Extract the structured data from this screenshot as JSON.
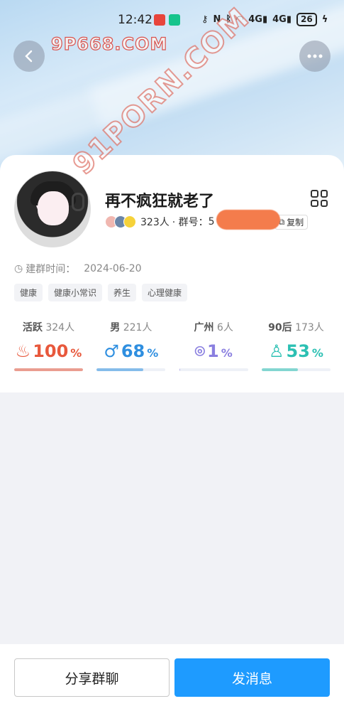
{
  "status_bar": {
    "time": "12:42",
    "battery": "26"
  },
  "watermarks": {
    "top": "9P668.COM",
    "diagonal": "91PORN.COM"
  },
  "group": {
    "name": "再不疯狂就老了",
    "member_count": "323人",
    "id_label": "· 群号：",
    "id_visible": "5",
    "copy_label": "复制",
    "created_label": "建群时间：",
    "created_date": "2024-06-20",
    "tags": [
      "健康",
      "健康小常识",
      "养生",
      "心理健康"
    ]
  },
  "stats": [
    {
      "label": "活跃",
      "count": "324人",
      "value": "100",
      "unit": "%",
      "color": "#e8583c",
      "fill": 1.0,
      "icon": "flame-icon",
      "glyph": "♨"
    },
    {
      "label": "男",
      "count": "221人",
      "value": "68",
      "unit": "%",
      "color": "#2f8fe0",
      "fill": 0.68,
      "icon": "male-icon",
      "glyph": "♂"
    },
    {
      "label": "广州",
      "count": "6人",
      "value": "1",
      "unit": "%",
      "color": "#8a7fe0",
      "fill": 0.01,
      "icon": "location-icon",
      "glyph": "⌾"
    },
    {
      "label": "90后",
      "count": "173人",
      "value": "53",
      "unit": "%",
      "color": "#2cc0b3",
      "fill": 0.53,
      "icon": "person-icon",
      "glyph": "♙"
    }
  ],
  "actions": {
    "share": "分享群聊",
    "send": "发消息"
  }
}
